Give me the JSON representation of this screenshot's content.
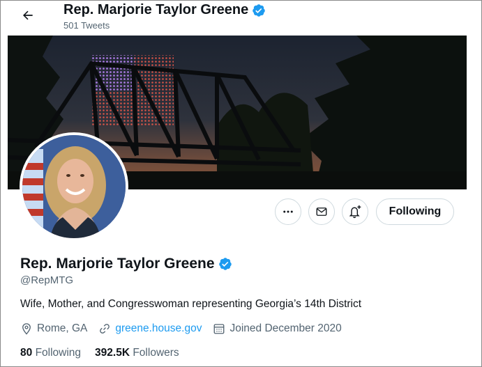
{
  "header": {
    "title": "Rep. Marjorie Taylor Greene",
    "tweet_count": "501 Tweets"
  },
  "banner": {
    "description_icon": "bridge-flag-banner"
  },
  "actions": {
    "more_icon": "more-horizontal-icon",
    "message_icon": "mail-icon",
    "notify_icon": "bell-plus-icon",
    "follow_label": "Following"
  },
  "profile": {
    "name": "Rep. Marjorie Taylor Greene",
    "handle": "@RepMTG",
    "bio": "Wife, Mother, and Congresswoman representing Georgia’s 14th District",
    "location": "Rome, GA",
    "website": "greene.house.gov",
    "joined": "Joined December 2020",
    "following_count": "80",
    "following_label": "Following",
    "followers_count": "392.5K",
    "followers_label": "Followers"
  },
  "colors": {
    "accent": "#1d9bf0",
    "text": "#0f1419",
    "secondary": "#536471",
    "border": "#cfd9de"
  }
}
